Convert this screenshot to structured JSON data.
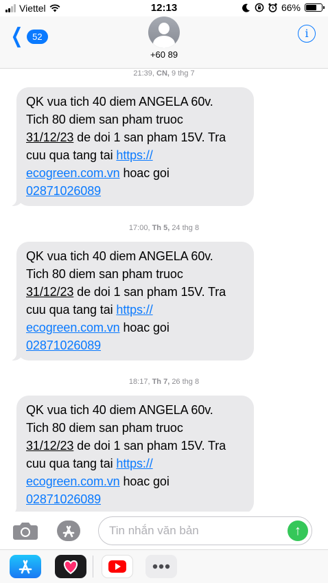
{
  "status_bar": {
    "carrier": "Viettel",
    "time": "12:13",
    "battery": "66%",
    "battery_level": 0.66
  },
  "header": {
    "unread_count": "52",
    "contact": "+60 89"
  },
  "messages": [
    {
      "timestamp_time": "21:39,",
      "timestamp_day": "CN,",
      "timestamp_date": "9 thg 7",
      "line1": "QK vua tich 40 diem ANGELA 60v.",
      "line2": "Tich 80 diem san pham truoc",
      "date": "31/12/23",
      "line3_rest": " de doi 1 san pham 15V. Tra",
      "line4_prefix": "cuu qua tang tai ",
      "link1": "https://",
      "link2": "ecogreen.com.vn",
      "line5_rest": " hoac goi",
      "phone": "02871026089"
    },
    {
      "timestamp_time": "17:00,",
      "timestamp_day": "Th 5,",
      "timestamp_date": "24 thg 8",
      "line1": "QK vua tich 40 diem ANGELA 60v.",
      "line2": "Tich 80 diem san pham truoc",
      "date": "31/12/23",
      "line3_rest": " de doi 1 san pham 15V. Tra",
      "line4_prefix": "cuu qua tang tai ",
      "link1": "https://",
      "link2": "ecogreen.com.vn",
      "line5_rest": " hoac goi",
      "phone": "02871026089"
    },
    {
      "timestamp_time": "18:17,",
      "timestamp_day": "Th 7,",
      "timestamp_date": "26 thg 8",
      "line1": "QK vua tich 40 diem ANGELA 60v.",
      "line2": "Tich 80 diem san pham truoc",
      "date": "31/12/23",
      "line3_rest": " de doi 1 san pham 15V. Tra",
      "line4_prefix": "cuu qua tang tai ",
      "link1": "https://",
      "link2": "ecogreen.com.vn",
      "line5_rest": " hoac goi",
      "phone": "02871026089"
    }
  ],
  "input": {
    "placeholder": "Tin nhắn văn bản"
  },
  "icons": {
    "camera": "camera-icon",
    "apps": "app-store-icon",
    "send": "arrow-up-icon",
    "info": "info-icon",
    "back": "chevron-left-icon",
    "drawer": [
      "app-store-icon",
      "digital-touch-icon",
      "youtube-icon",
      "more-icon"
    ]
  },
  "colors": {
    "accent": "#0a7aff",
    "bubble": "#e9e9eb",
    "send": "#35c759",
    "youtube": "#ff0000"
  }
}
